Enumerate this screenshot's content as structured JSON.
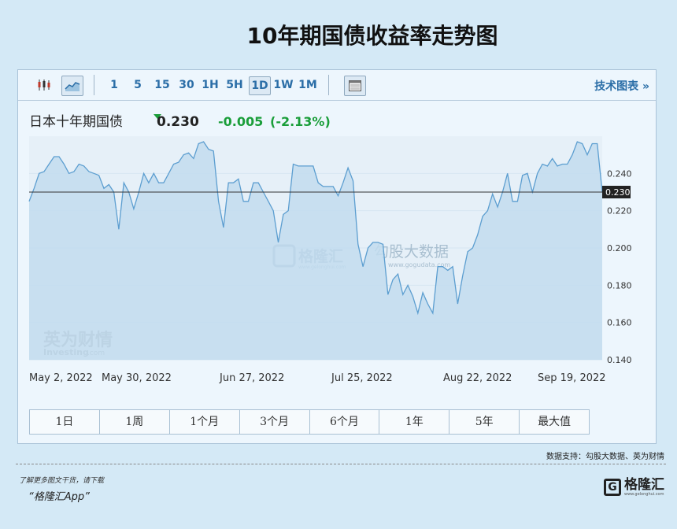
{
  "page": {
    "title": "10年期国债收益率走势图"
  },
  "toolbar": {
    "timeframes": [
      "1",
      "5",
      "15",
      "30",
      "1H",
      "5H",
      "1D",
      "1W",
      "1M"
    ],
    "active_timeframe": "1D",
    "tech_link": "技术图表 »"
  },
  "quote": {
    "name": "日本十年期国债",
    "price": "0.230",
    "change": "-0.005",
    "change_pct": "(-2.13%)",
    "down_color": "#1a9e3a"
  },
  "watermarks": {
    "gelonghui": "格隆汇",
    "gelonghui_url": "www.gelonghui.com",
    "gogudata": "勾股大数据",
    "gogudata_url": "www.gogudata.com",
    "investing_cn": "英为财情",
    "investing_en": "Investing",
    "investing_suffix": ".com"
  },
  "chart_data": {
    "type": "area",
    "title": "",
    "xlabel": "",
    "ylabel": "",
    "x_ticks": [
      "May 2, 2022",
      "May 30, 2022",
      "Jun 27, 2022",
      "Jul 25, 2022",
      "Aug 22, 2022",
      "Sep 19, 2022"
    ],
    "y_ticks": [
      "0.240",
      "0.220",
      "0.200",
      "0.180",
      "0.160",
      "0.140"
    ],
    "ylim": [
      0.14,
      0.26
    ],
    "current_value": 0.23,
    "current_label": "0.230",
    "series": [
      {
        "values": [
          0.225,
          0.232,
          0.24,
          0.241,
          0.245,
          0.249,
          0.249,
          0.245,
          0.24,
          0.241,
          0.245,
          0.244,
          0.241,
          0.24,
          0.239,
          0.232,
          0.234,
          0.23,
          0.21,
          0.235,
          0.23,
          0.221,
          0.23,
          0.24,
          0.235,
          0.24,
          0.235,
          0.235,
          0.24,
          0.245,
          0.246,
          0.25,
          0.251,
          0.248,
          0.256,
          0.257,
          0.253,
          0.252,
          0.225,
          0.211,
          0.235,
          0.235,
          0.237,
          0.225,
          0.225,
          0.235,
          0.235,
          0.23,
          0.225,
          0.22,
          0.203,
          0.218,
          0.22,
          0.245,
          0.244,
          0.244,
          0.244,
          0.244,
          0.235,
          0.233,
          0.233,
          0.233,
          0.228,
          0.235,
          0.243,
          0.236,
          0.202,
          0.19,
          0.2,
          0.203,
          0.203,
          0.202,
          0.175,
          0.183,
          0.186,
          0.175,
          0.18,
          0.174,
          0.165,
          0.176,
          0.17,
          0.165,
          0.19,
          0.19,
          0.188,
          0.19,
          0.17,
          0.185,
          0.198,
          0.2,
          0.207,
          0.217,
          0.22,
          0.229,
          0.222,
          0.23,
          0.24,
          0.225,
          0.225,
          0.239,
          0.24,
          0.23,
          0.24,
          0.245,
          0.244,
          0.248,
          0.244,
          0.245,
          0.245,
          0.25,
          0.257,
          0.256,
          0.25,
          0.256,
          0.256,
          0.23
        ]
      }
    ]
  },
  "range_buttons": [
    "1日",
    "1周",
    "1个月",
    "3个月",
    "6个月",
    "1年",
    "5年",
    "最大值"
  ],
  "footer": {
    "source": "数据支持：勾股大数据、英为财情",
    "note": "了解更多图文干货，请下载",
    "app": "“格隆汇App”",
    "logo_text": "格隆汇",
    "logo_url": "www.gelonghui.com"
  }
}
